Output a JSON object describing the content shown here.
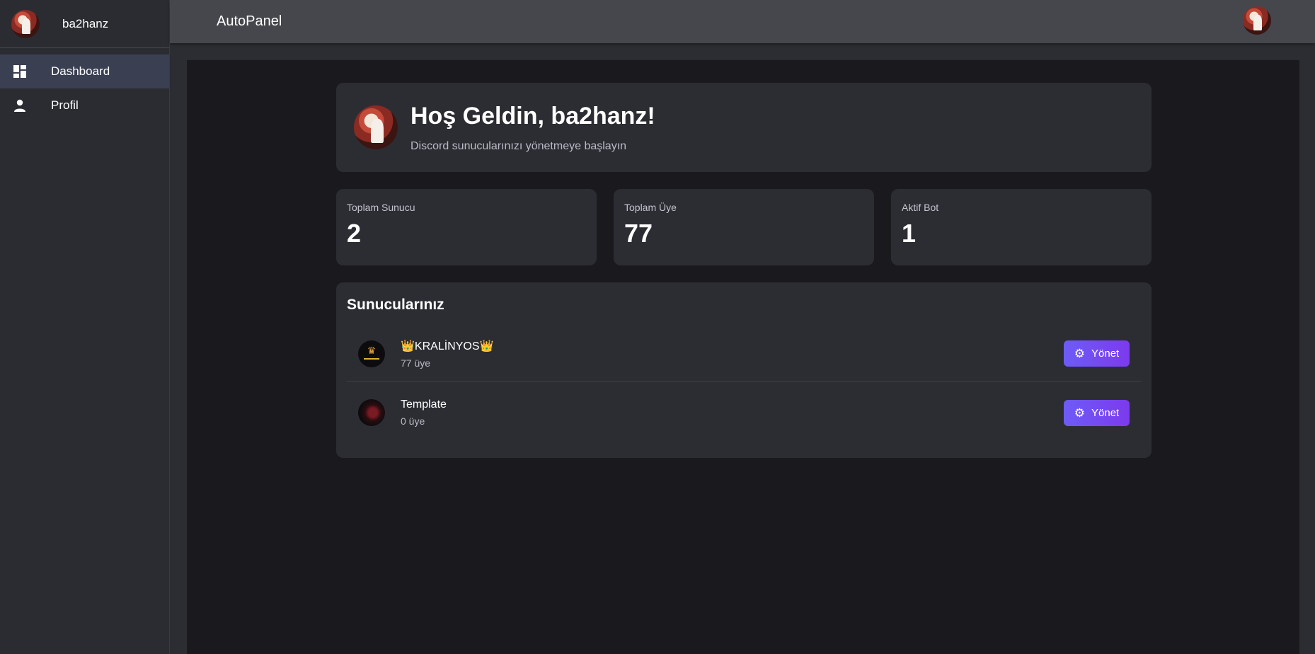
{
  "sidebar": {
    "username": "ba2hanz",
    "items": [
      {
        "label": "Dashboard",
        "icon": "dashboard-icon",
        "active": true
      },
      {
        "label": "Profil",
        "icon": "person-icon",
        "active": false
      }
    ]
  },
  "topbar": {
    "title": "AutoPanel"
  },
  "welcome": {
    "title": "Hoş Geldin, ba2hanz!",
    "subtitle": "Discord sunucularınızı yönetmeye başlayın"
  },
  "stats": [
    {
      "label": "Toplam Sunucu",
      "value": "2"
    },
    {
      "label": "Toplam Üye",
      "value": "77"
    },
    {
      "label": "Aktif Bot",
      "value": "1"
    }
  ],
  "servers": {
    "title": "Sunucularınız",
    "items": [
      {
        "name": "👑KRALİNYOS👑",
        "members": "77 üye",
        "button": "Yönet"
      },
      {
        "name": "Template",
        "members": "0 üye",
        "button": "Yönet"
      }
    ]
  },
  "colors": {
    "accent": "#6d5cf6",
    "sidebar_active": "#3a3f52",
    "card": "#2c2d33",
    "main_bg": "#1a1a1e"
  }
}
